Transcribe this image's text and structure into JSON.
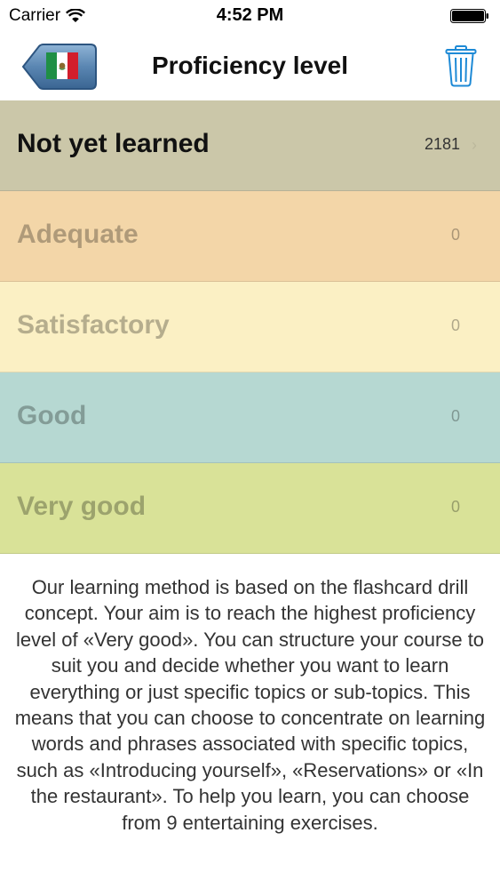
{
  "status_bar": {
    "carrier": "Carrier",
    "time": "4:52 PM",
    "icons": [
      "wifi-icon",
      "battery-icon"
    ]
  },
  "nav": {
    "title": "Proficiency level",
    "back_icon": "mexico-flag-back-icon",
    "trash_icon": "trash-icon",
    "accent_color": "#1e8ad6"
  },
  "levels": [
    {
      "label": "Not yet learned",
      "count": "2181",
      "color": "#cbc7a9",
      "active": true
    },
    {
      "label": "Adequate",
      "count": "0",
      "color": "#f3d6a8",
      "active": false
    },
    {
      "label": "Satisfactory",
      "count": "0",
      "color": "#fbf0c4",
      "active": false
    },
    {
      "label": "Good",
      "count": "0",
      "color": "#b6d8d2",
      "active": false
    },
    {
      "label": "Very good",
      "count": "0",
      "color": "#d9e298",
      "active": false
    }
  ],
  "description": "Our learning method is based on the flashcard drill concept. Your aim is to reach the highest proficiency level of «Very good». You can structure your course to suit you and decide whether you want to learn everything or just specific topics or sub-topics. This means that you can choose to concentrate on learning words and phrases associated with specific topics, such as «Introducing yourself», «Reservations» or «In the restaurant». To help you learn, you can choose from 9 entertaining exercises."
}
